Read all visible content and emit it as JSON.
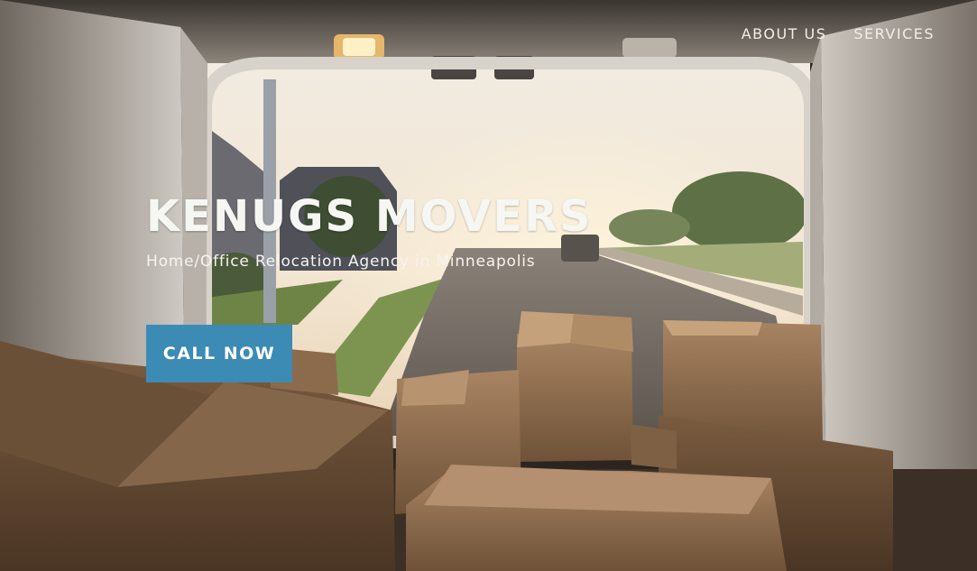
{
  "nav": {
    "items": [
      {
        "label": "ABOUT US"
      },
      {
        "label": "SERVICES"
      }
    ]
  },
  "hero": {
    "title": "KENUGS MOVERS",
    "subtitle": "Home/Office Relocation Agency in Minneapolis",
    "cta_label": "CALL NOW",
    "image_subject": "cardboard boxes in the back of a moving van at sunset"
  },
  "colors": {
    "cta_background": "#3c8bb5",
    "text": "#f6f7f3"
  }
}
